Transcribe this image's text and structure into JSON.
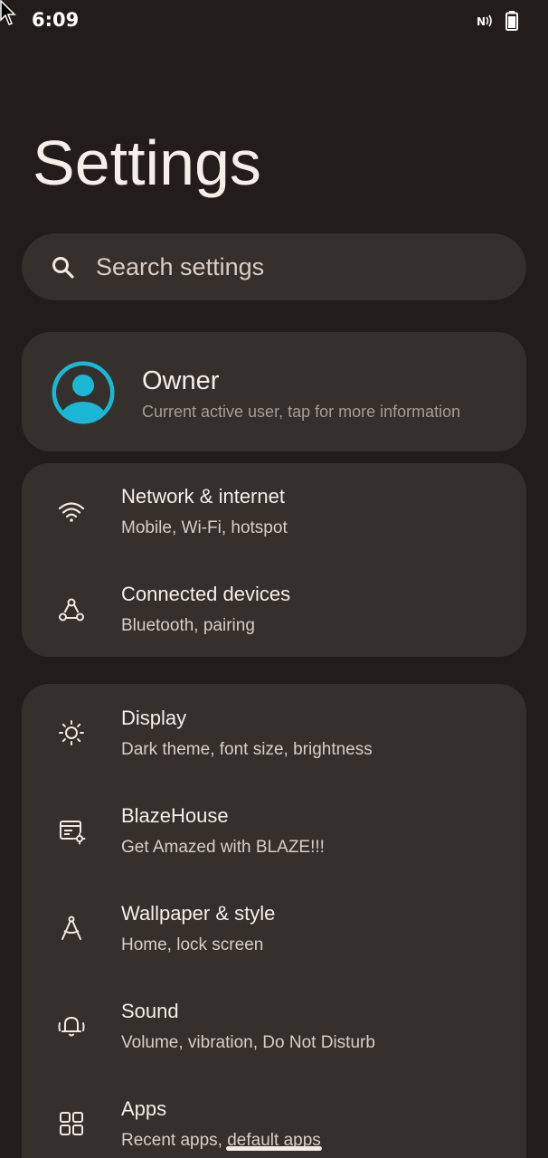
{
  "status_bar": {
    "time": "6:09"
  },
  "page": {
    "title": "Settings"
  },
  "search": {
    "placeholder": "Search settings"
  },
  "owner": {
    "name": "Owner",
    "subtitle": "Current active user, tap for more information",
    "avatar_color": "#1ab8d4"
  },
  "items": [
    {
      "title": "Network & internet",
      "subtitle": "Mobile, Wi-Fi, hotspot",
      "icon": "wifi-icon"
    },
    {
      "title": "Connected devices",
      "subtitle": "Bluetooth, pairing",
      "icon": "connected-devices-icon"
    },
    {
      "title": "Display",
      "subtitle": "Dark theme, font size, brightness",
      "icon": "brightness-icon"
    },
    {
      "title": "BlazeHouse",
      "subtitle": "Get Amazed with BLAZE!!!",
      "icon": "blazehouse-icon"
    },
    {
      "title": "Wallpaper & style",
      "subtitle": "Home, lock screen",
      "icon": "wallpaper-style-icon"
    },
    {
      "title": "Sound",
      "subtitle": "Volume, vibration, Do Not Disturb",
      "icon": "sound-bell-icon"
    },
    {
      "title": "Apps",
      "subtitle": "Recent apps, default apps",
      "icon": "apps-grid-icon"
    }
  ],
  "colors": {
    "background": "#221d1b",
    "card": "#35302c",
    "text_primary": "#f6eee8",
    "text_secondary": "#d8cec6",
    "accent": "#1ab8d4"
  }
}
